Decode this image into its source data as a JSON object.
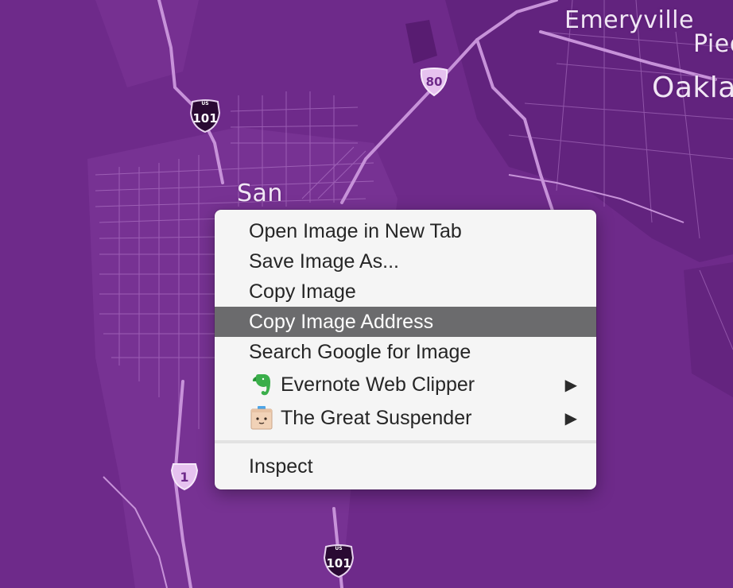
{
  "map": {
    "labels": {
      "emeryville": "Emeryville",
      "oakland": "Oaklan",
      "piedmont": "Pied",
      "sf": "San"
    },
    "shields": {
      "us101_top": {
        "top": "US",
        "number": "101"
      },
      "i80": {
        "number": "80"
      },
      "ca1": {
        "number": "1"
      },
      "us101_bottom": {
        "top": "US",
        "number": "101"
      }
    }
  },
  "menu": {
    "items": [
      {
        "label": "Open Image in New Tab"
      },
      {
        "label": "Save Image As..."
      },
      {
        "label": "Copy Image"
      },
      {
        "label": "Copy Image Address",
        "highlighted": true
      },
      {
        "label": "Search Google for Image"
      },
      {
        "label": "Evernote Web Clipper",
        "icon": "evernote-elephant-icon",
        "submenu": true
      },
      {
        "label": "The Great Suspender",
        "icon": "great-suspender-face-icon",
        "submenu": true
      },
      {
        "label": "Inspect"
      }
    ],
    "submenu_arrow": "▶"
  },
  "colors": {
    "map_bg": "#6e2a8a",
    "menu_bg": "#f5f5f5",
    "highlight": "#6b6b6d"
  }
}
